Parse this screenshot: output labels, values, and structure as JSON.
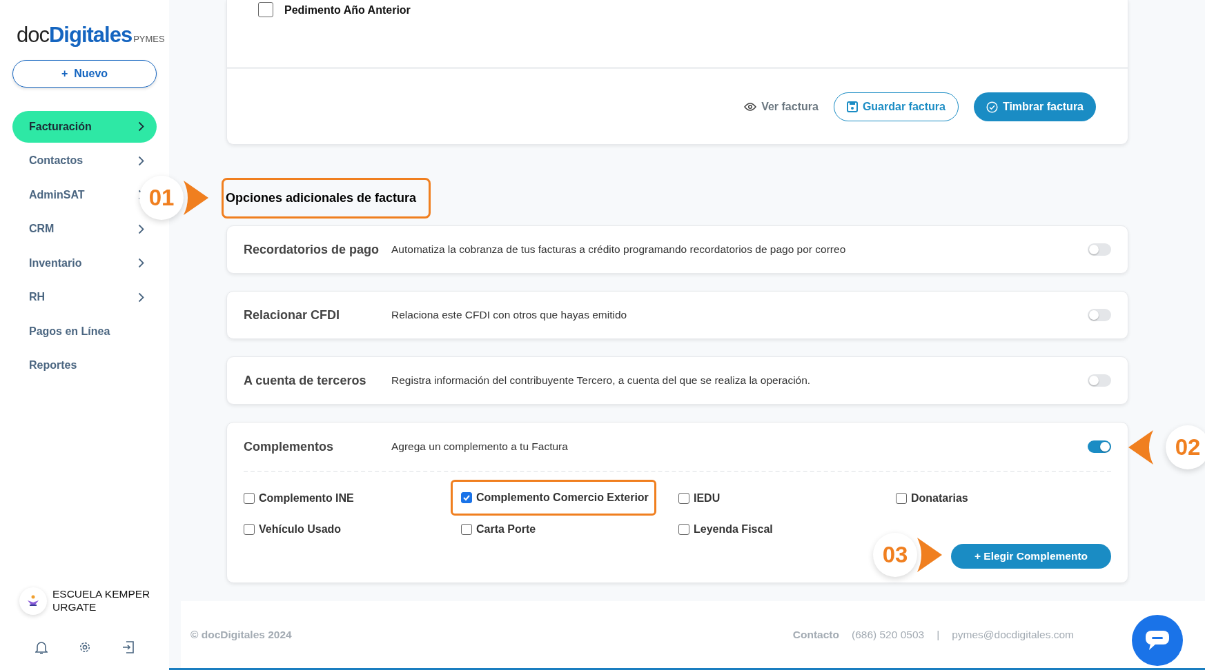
{
  "sidebar": {
    "logo": {
      "part_1": "doc",
      "part_2": "Digitales",
      "part_3": "PYMES"
    },
    "new_button": {
      "icon": "+",
      "label": "Nuevo"
    },
    "items": [
      {
        "label": "Facturación",
        "selected": true,
        "has_submenu": true
      },
      {
        "label": "Contactos",
        "selected": false,
        "has_submenu": true
      },
      {
        "label": "AdminSAT",
        "selected": false,
        "has_submenu": true
      },
      {
        "label": "CRM",
        "selected": false,
        "has_submenu": true
      },
      {
        "label": "Inventario",
        "selected": false,
        "has_submenu": true
      },
      {
        "label": "RH",
        "selected": false,
        "has_submenu": true
      },
      {
        "label": "Pagos en Línea",
        "selected": false,
        "has_submenu": false
      },
      {
        "label": "Reportes",
        "selected": false,
        "has_submenu": false
      }
    ],
    "account": {
      "name": "ESCUELA KEMPER URGATE"
    }
  },
  "invoice_card": {
    "checkbox": {
      "label": "Pedimento Año Anterior",
      "checked": false
    },
    "actions": [
      {
        "kind": "link",
        "label": "Ver factura"
      },
      {
        "kind": "outline",
        "label": "Guardar factura"
      },
      {
        "kind": "primary",
        "label": "Timbrar factura"
      }
    ]
  },
  "additional_options": {
    "heading": "Opciones adicionales de factura",
    "callout": "01",
    "options": [
      {
        "title": "Recordatorios de pago",
        "description": "Automatiza la cobranza de tus facturas a crédito programando recordatorios de pago por correo",
        "on": false
      },
      {
        "title": "Relacionar CFDI",
        "description": "Relaciona este CFDI con otros que hayas emitido",
        "on": false
      },
      {
        "title": "A cuenta de terceros",
        "description": "Registra información del contribuyente Tercero, a cuenta del que se realiza la operación.",
        "on": false
      }
    ],
    "complementos": {
      "title": "Complementos",
      "description": "Agrega un complemento a tu Factura",
      "on": true,
      "toggle_callout": "02",
      "checkboxes": [
        {
          "label": "Complemento INE",
          "checked": false,
          "highlighted": false
        },
        {
          "label": "Complemento Comercio Exterior",
          "checked": true,
          "highlighted": true
        },
        {
          "label": "IEDU",
          "checked": false,
          "highlighted": false
        },
        {
          "label": "Donatarias",
          "checked": false,
          "highlighted": false
        },
        {
          "label": "Vehículo Usado",
          "checked": false,
          "highlighted": false
        },
        {
          "label": "Carta Porte",
          "checked": false,
          "highlighted": false
        },
        {
          "label": "Leyenda Fiscal",
          "checked": false,
          "highlighted": false
        }
      ],
      "button": {
        "label": "+ Elegir Complemento",
        "callout": "03"
      }
    }
  },
  "footer": {
    "copyright": "© docDigitales 2024",
    "contact_label": "Contacto",
    "phone": "(686) 520 0503",
    "separator": "|",
    "email": "pymes@docdigitales.com"
  }
}
